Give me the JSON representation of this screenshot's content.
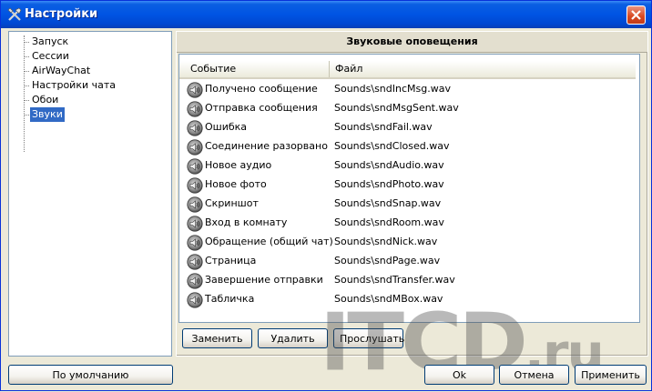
{
  "window": {
    "title": "Настройки"
  },
  "nav": {
    "items": [
      {
        "label": "Запуск"
      },
      {
        "label": "Сессии"
      },
      {
        "label": "AirWayChat"
      },
      {
        "label": "Настройки чата"
      },
      {
        "label": "Обои"
      },
      {
        "label": "Звуки",
        "selected": true
      }
    ]
  },
  "panel": {
    "title": "Звуковые оповещения",
    "columns": {
      "event": "Событие",
      "file": "Файл"
    },
    "rows": [
      {
        "event": "Получено сообщение",
        "file": "Sounds\\sndIncMsg.wav"
      },
      {
        "event": "Отправка сообщения",
        "file": "Sounds\\sndMsgSent.wav"
      },
      {
        "event": "Ошибка",
        "file": "Sounds\\sndFail.wav"
      },
      {
        "event": "Соединение разорвано",
        "file": "Sounds\\sndClosed.wav"
      },
      {
        "event": "Новое аудио",
        "file": "Sounds\\sndAudio.wav"
      },
      {
        "event": "Новое фото",
        "file": "Sounds\\sndPhoto.wav"
      },
      {
        "event": "Скриншот",
        "file": "Sounds\\sndSnap.wav"
      },
      {
        "event": "Вход в комнату",
        "file": "Sounds\\sndRoom.wav"
      },
      {
        "event": "Обращение (общий чат)",
        "file": "Sounds\\sndNick.wav"
      },
      {
        "event": "Страница",
        "file": "Sounds\\sndPage.wav"
      },
      {
        "event": "Завершение отправки",
        "file": "Sounds\\sndTransfer.wav"
      },
      {
        "event": "Табличка",
        "file": "Sounds\\sndMBox.wav"
      }
    ],
    "buttons": {
      "replace": "Заменить",
      "delete": "Удалить",
      "listen": "Прослушать"
    }
  },
  "footer": {
    "defaults": "По умолчанию",
    "ok": "Ok",
    "cancel": "Отмена",
    "apply": "Применить"
  },
  "watermark": {
    "main": "ITCD",
    "suffix": ".ru"
  },
  "colors": {
    "title_bar": "#0054e3",
    "selection": "#316ac5",
    "window_bg": "#ece9d8"
  },
  "icons": {
    "row_icon": "speaker-icon",
    "title_icon": "tools-icon",
    "close": "close-icon"
  }
}
